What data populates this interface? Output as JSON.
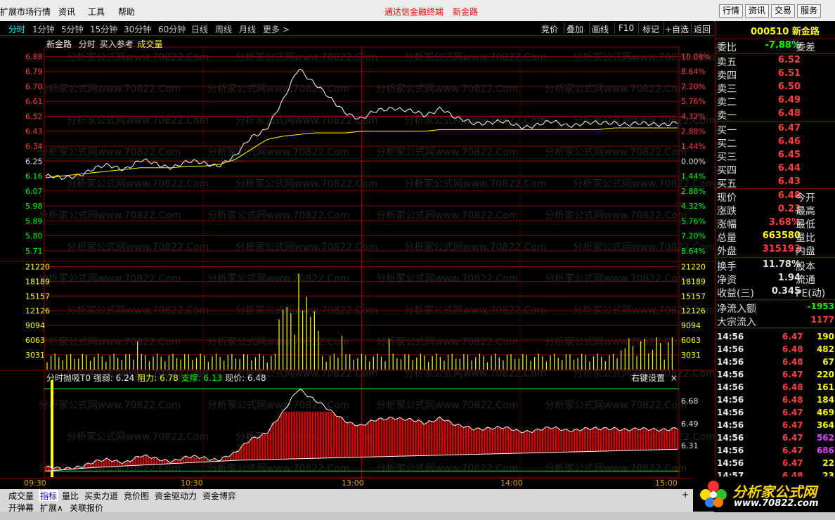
{
  "topbar": {
    "menus": [
      "扩展市场行情",
      "资讯",
      "工具",
      "帮助"
    ],
    "title_app": "通达信金融终端",
    "title_stock": "新金路",
    "buttons": [
      "行情",
      "资讯",
      "交易",
      "服务"
    ]
  },
  "period_bar": {
    "items": [
      "分时",
      "1分钟",
      "5分钟",
      "15分钟",
      "30分钟",
      "60分钟",
      "日线",
      "周线",
      "月线",
      "更多 >"
    ],
    "selected": "分时",
    "right_items": [
      "竞价",
      "叠加",
      "画线",
      "F10",
      "标记",
      "+自选",
      "返回"
    ]
  },
  "chart_header": {
    "name": "新金路",
    "mode": "分时",
    "ref": "买入参考",
    "vol_label": "成交量"
  },
  "watermark": "分析家公式网www.70822.Com",
  "indicator_header": {
    "name": "分时抛吸T0",
    "strength_label": "强弱:",
    "strength": "6.24",
    "resist_label": "阻力:",
    "resist": "6.78",
    "support_label": "支撑:",
    "support": "6.13",
    "price_label": "现价:",
    "price": "6.48",
    "settings": "右键设置",
    "close": "×"
  },
  "time_labels": [
    "09:30",
    "10:30",
    "13:00",
    "14:00",
    "15:00"
  ],
  "chart_data": [
    {
      "type": "line",
      "series": [
        {
          "values": [
            6.16,
            6.14,
            6.17,
            6.2,
            6.22,
            6.21,
            6.25,
            6.23,
            6.22,
            6.24,
            6.24,
            6.23,
            6.27,
            6.4,
            6.45,
            6.6,
            6.82,
            6.72,
            6.62,
            6.55,
            6.5,
            6.55,
            6.58,
            6.55,
            6.52,
            6.58,
            6.5,
            6.48,
            6.49,
            6.48,
            6.46,
            6.47,
            6.48,
            6.47,
            6.48,
            6.47,
            6.49,
            6.47,
            6.47,
            6.48,
            6.48
          ]
        }
      ],
      "avg_values": [
        6.15,
        6.16,
        6.17,
        6.18,
        6.19,
        6.2,
        6.21,
        6.21,
        6.21,
        6.22,
        6.22,
        6.23,
        6.26,
        6.32,
        6.38,
        6.4,
        6.41,
        6.42,
        6.42,
        6.42,
        6.43,
        6.43,
        6.43,
        6.43,
        6.43,
        6.44,
        6.44,
        6.44,
        6.44,
        6.44,
        6.44,
        6.44,
        6.44,
        6.44,
        6.44,
        6.44,
        6.45,
        6.45,
        6.45,
        6.45,
        6.45
      ],
      "y_ticks": [
        "6.88",
        "6.79",
        "6.70",
        "6.61",
        "6.52",
        "6.43",
        "6.34",
        "6.25",
        "6.16",
        "6.07",
        "5.98",
        "5.89",
        "5.80",
        "5.71"
      ],
      "pct_ticks": [
        "10.08%",
        "8.64%",
        "7.20%",
        "5.76%",
        "4.32%",
        "2.88%",
        "1.44%",
        "0.00%",
        "1.44%",
        "2.88%",
        "4.32%",
        "5.76%",
        "7.20%",
        "8.64%"
      ],
      "ylim": [
        5.65,
        6.92
      ]
    },
    {
      "type": "bar",
      "y_ticks": [
        "21220",
        "18189",
        "15157",
        "12126",
        "9094",
        "6063",
        "3031"
      ],
      "ylim": [
        0,
        22000
      ]
    },
    {
      "type": "area",
      "y_ticks": [
        "6.68",
        "6.49",
        "6.31"
      ],
      "ylim": [
        6.05,
        6.85
      ]
    }
  ],
  "right_panel": {
    "code": "000510",
    "name": "新金路",
    "wei_bi_label": "委比",
    "wei_bi": "-7.88%",
    "wei_cha_label": "委差",
    "sells": [
      {
        "label": "卖五",
        "price": "6.52"
      },
      {
        "label": "卖四",
        "price": "6.51"
      },
      {
        "label": "卖三",
        "price": "6.50"
      },
      {
        "label": "卖二",
        "price": "6.49"
      },
      {
        "label": "卖一",
        "price": "6.48"
      }
    ],
    "buys": [
      {
        "label": "买一",
        "price": "6.47"
      },
      {
        "label": "买二",
        "price": "6.46"
      },
      {
        "label": "买三",
        "price": "6.45"
      },
      {
        "label": "买四",
        "price": "6.44"
      },
      {
        "label": "买五",
        "price": "6.43"
      }
    ],
    "stats": [
      {
        "label": "现价",
        "value": "6.48",
        "right": "今开",
        "color": "#ff4040"
      },
      {
        "label": "涨跌",
        "value": "0.23",
        "right": "最高",
        "color": "#ff4040"
      },
      {
        "label": "涨幅",
        "value": "3.68%",
        "right": "最低",
        "color": "#ff4040"
      },
      {
        "label": "总量",
        "value": "663580",
        "right": "量比",
        "color": "#ffff00"
      },
      {
        "label": "外盘",
        "value": "315193",
        "right": "内盘",
        "color": "#ff4040"
      }
    ],
    "stats2": [
      {
        "label": "换手",
        "value": "11.78%",
        "right": "股本",
        "color": "#e0e0e0"
      },
      {
        "label": "净资",
        "value": "1.94",
        "right": "流通",
        "color": "#e0e0e0"
      },
      {
        "label": "收益(三)",
        "value": "0.345",
        "right": "PE(动)",
        "color": "#e0e0e0"
      }
    ],
    "flows": [
      {
        "label": "净流入额",
        "value": "-1953",
        "color": "#00ff00"
      },
      {
        "label": "大宗流入",
        "value": "1177",
        "color": "#ff4040"
      }
    ],
    "ticks": [
      {
        "time": "14:56",
        "price": "6.47",
        "vol": "190",
        "vc": "#ffff00"
      },
      {
        "time": "14:56",
        "price": "6.48",
        "vol": "482",
        "vc": "#ffff00"
      },
      {
        "time": "14:56",
        "price": "6.48",
        "vol": "67",
        "vc": "#ffff00"
      },
      {
        "time": "14:56",
        "price": "6.47",
        "vol": "220",
        "vc": "#ffff00"
      },
      {
        "time": "14:56",
        "price": "6.48",
        "vol": "161",
        "vc": "#ffff00"
      },
      {
        "time": "14:56",
        "price": "6.48",
        "vol": "184",
        "vc": "#ffff00"
      },
      {
        "time": "14:56",
        "price": "6.47",
        "vol": "469",
        "vc": "#ffff00"
      },
      {
        "time": "14:56",
        "price": "6.47",
        "vol": "364",
        "vc": "#ffff00"
      },
      {
        "time": "14:56",
        "price": "6.47",
        "vol": "562",
        "vc": "#e040ff"
      },
      {
        "time": "14:56",
        "price": "6.47",
        "vol": "686",
        "vc": "#e040ff"
      },
      {
        "time": "14:56",
        "price": "6.47",
        "vol": "22",
        "vc": "#ffff00"
      },
      {
        "time": "14:57",
        "price": "6.48",
        "vol": "23",
        "vc": "#ffff00"
      }
    ]
  },
  "bottom_tabs": [
    "成交量",
    "指标",
    "量比",
    "买卖力道",
    "竞价图",
    "资金驱动力",
    "资金博弈"
  ],
  "bottom_tabs_active": "指标",
  "bottom_tabs2": [
    "开弹幕",
    "扩展∧",
    "关联报价"
  ],
  "logo": {
    "title": "分析家公式网",
    "url": "www.70822.com"
  },
  "colors": {
    "up": "#ff4040",
    "down": "#00ff00",
    "grid": "#8a0000",
    "avg": "#ffff00",
    "bg": "#000000"
  }
}
